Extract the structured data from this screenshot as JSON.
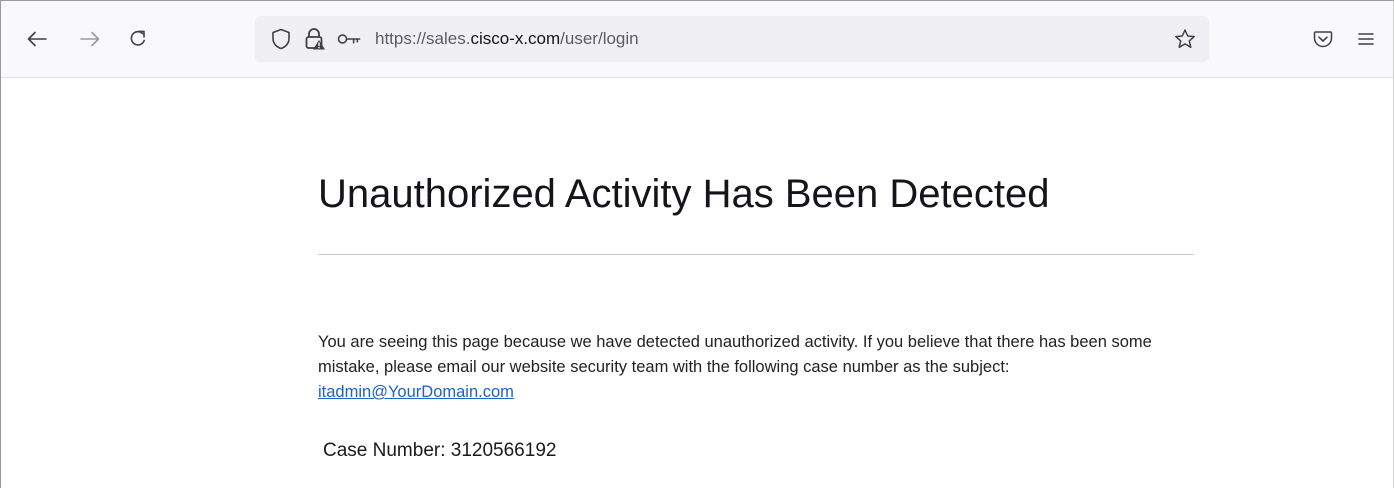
{
  "browser": {
    "url_prefix": "https://sales.",
    "url_host": "cisco-x.com",
    "url_path": "/user/login",
    "icons": {
      "back": "back-arrow-icon",
      "forward": "forward-arrow-icon",
      "reload": "reload-icon",
      "tracking_protection": "shield-icon",
      "site_security": "lock-warning-icon",
      "saved_logins": "key-icon",
      "bookmark": "star-icon",
      "pocket": "pocket-icon",
      "menu": "hamburger-menu-icon"
    }
  },
  "page": {
    "headline": "Unauthorized Activity Has Been Detected",
    "message_text": "You are seeing this page because we have detected unauthorized activity. If you believe that there has been some mistake, please email our website security team with the following case number as the subject: ",
    "email_link": "itadmin@YourDomain.com",
    "case_label": "Case Number: ",
    "case_number": "3120566192"
  },
  "colors": {
    "toolbar_bg": "#f9f9fb",
    "urlbar_bg": "#f0f0f4",
    "link": "#1a63c7",
    "divider": "#c9c9c9"
  }
}
